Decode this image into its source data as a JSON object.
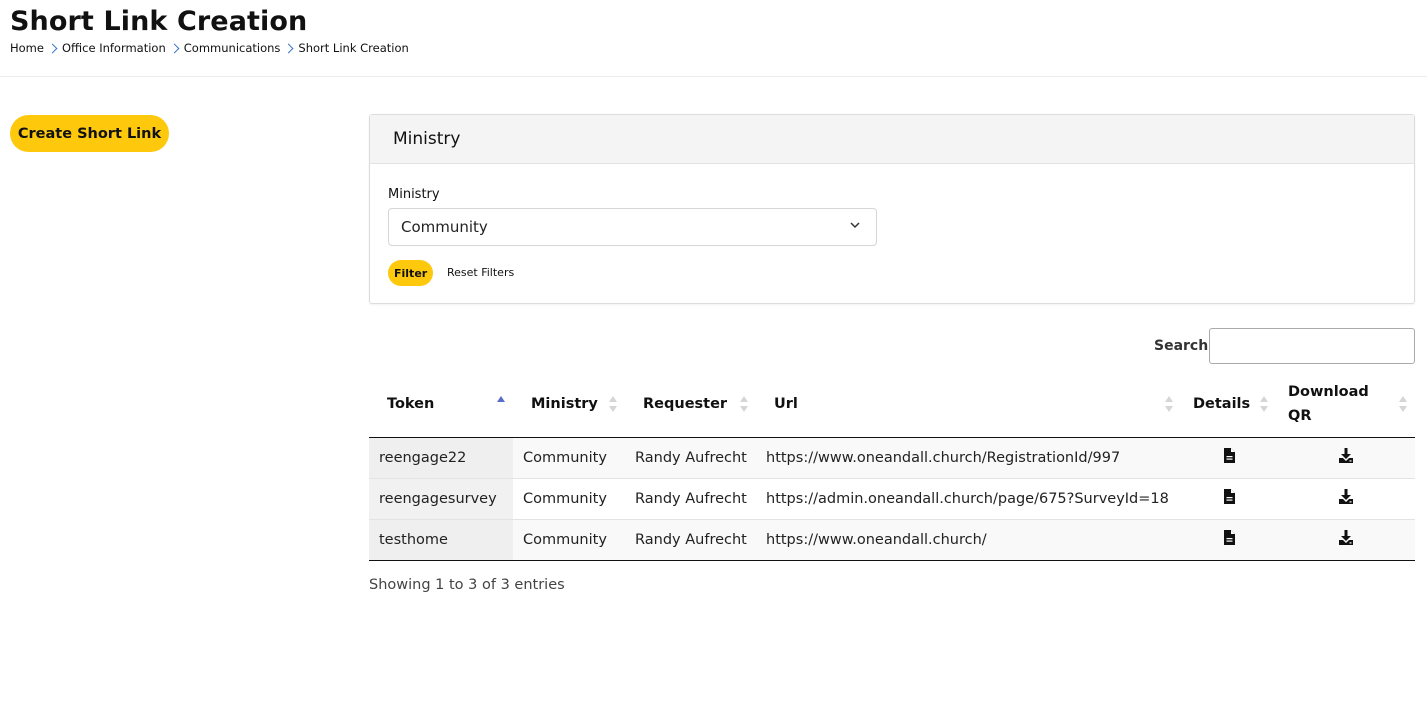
{
  "header": {
    "title": "Short Link Creation",
    "breadcrumb": [
      "Home",
      "Office Information",
      "Communications",
      "Short Link Creation"
    ]
  },
  "actions": {
    "create_label": "Create Short Link"
  },
  "filter_panel": {
    "title": "Ministry",
    "field_label": "Ministry",
    "selected": "Community",
    "filter_label": "Filter",
    "reset_label": "Reset Filters"
  },
  "search": {
    "label": "Search:",
    "value": ""
  },
  "table": {
    "columns": [
      "Token",
      "Ministry",
      "Requester",
      "Url",
      "Details",
      "Download QR"
    ],
    "sorted_column": "Token",
    "rows": [
      {
        "token": "reengage22",
        "ministry": "Community",
        "requester": "Randy Aufrecht",
        "url": "https://www.oneandall.church/RegistrationId/997",
        "details_icon": "document-icon",
        "download_icon": "download-icon"
      },
      {
        "token": "reengagesurvey",
        "ministry": "Community",
        "requester": "Randy Aufrecht",
        "url": "https://admin.oneandall.church/page/675?SurveyId=18",
        "details_icon": "document-icon",
        "download_icon": "download-icon"
      },
      {
        "token": "testhome",
        "ministry": "Community",
        "requester": "Randy Aufrecht",
        "url": "https://www.oneandall.church/",
        "details_icon": "document-icon",
        "download_icon": "download-icon"
      }
    ]
  },
  "info": "Showing 1 to 3 of 3 entries",
  "colors": {
    "accent": "#fec80d",
    "sort_active": "#5b6bc9",
    "breadcrumb_chevron": "#3a78c9"
  }
}
